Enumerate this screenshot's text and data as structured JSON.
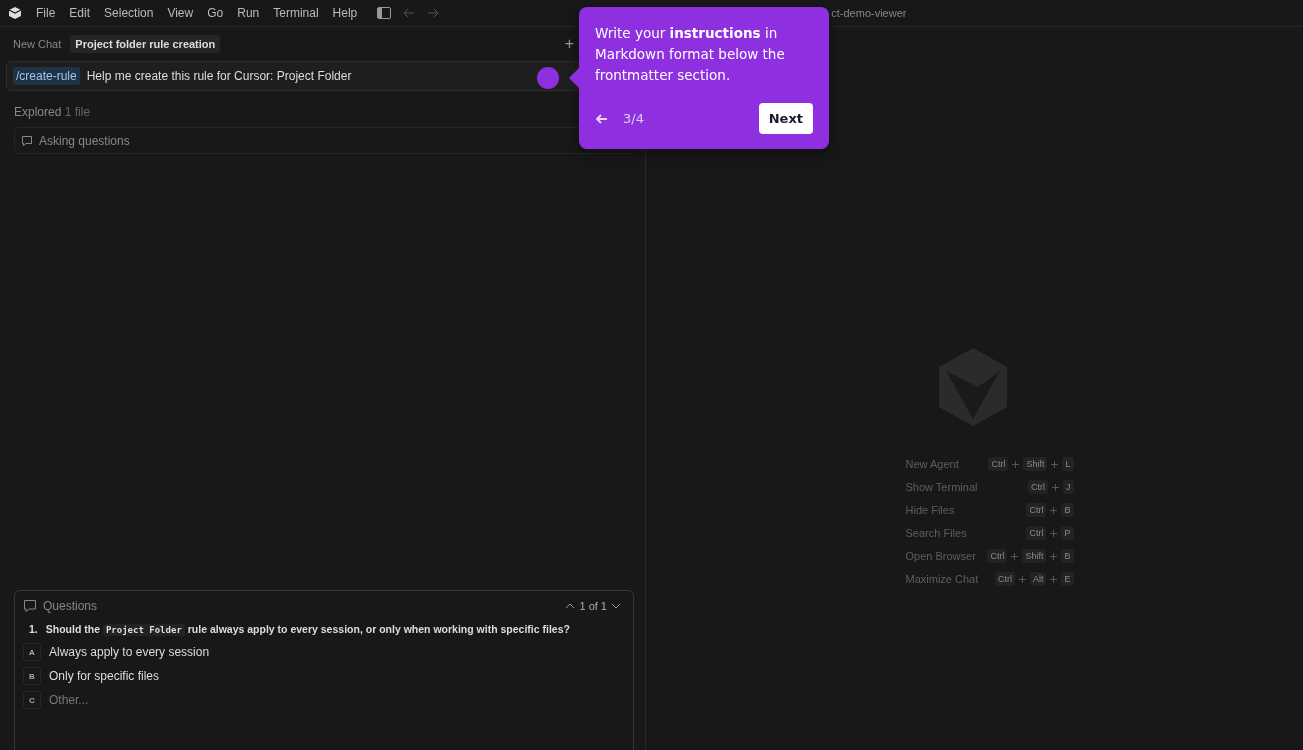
{
  "menu": [
    "File",
    "Edit",
    "Selection",
    "View",
    "Go",
    "Run",
    "Terminal",
    "Help"
  ],
  "window": {
    "title": "ct-demo-viewer"
  },
  "chat": {
    "tabs": [
      {
        "label": "New Chat",
        "selected": false
      },
      {
        "label": "Project folder rule creation",
        "selected": true
      }
    ],
    "add_button": "+",
    "prompt": {
      "command": "/create-rule",
      "text": "Help me create this rule for Cursor: Project Folder"
    },
    "explored": {
      "label": "Explored",
      "count": "1 file"
    },
    "status": "Asking questions",
    "questions": {
      "title": "Questions",
      "pager": "1 of 1",
      "number": "1.",
      "question": [
        {
          "kind": "text",
          "text": "Should the"
        },
        {
          "kind": "code",
          "text": "Project Folder"
        },
        {
          "kind": "text",
          "text": "rule always apply to every session, or only when working with specific files?"
        }
      ],
      "options": [
        {
          "kind": "answer",
          "letter": "A",
          "text": "Always apply to every session"
        },
        {
          "kind": "answer",
          "letter": "B",
          "text": "Only for specific files"
        },
        {
          "kind": "other",
          "letter": "C",
          "text": "Other..."
        }
      ]
    }
  },
  "tour": {
    "text": "Write your **instructions** in Markdown format below the frontmatter section.",
    "step": "3/4",
    "next": "Next"
  },
  "shortcuts": [
    {
      "label": "New Agent",
      "keys": [
        "Ctrl",
        "Shift",
        "L"
      ]
    },
    {
      "label": "Show Terminal",
      "keys": [
        "Ctrl",
        "J"
      ]
    },
    {
      "label": "Hide Files",
      "keys": [
        "Ctrl",
        "B"
      ]
    },
    {
      "label": "Search Files",
      "keys": [
        "Ctrl",
        "P"
      ]
    },
    {
      "label": "Open Browser",
      "keys": [
        "Ctrl",
        "Shift",
        "B"
      ]
    },
    {
      "label": "Maximize Chat",
      "keys": [
        "Ctrl",
        "Alt",
        "E"
      ]
    }
  ]
}
